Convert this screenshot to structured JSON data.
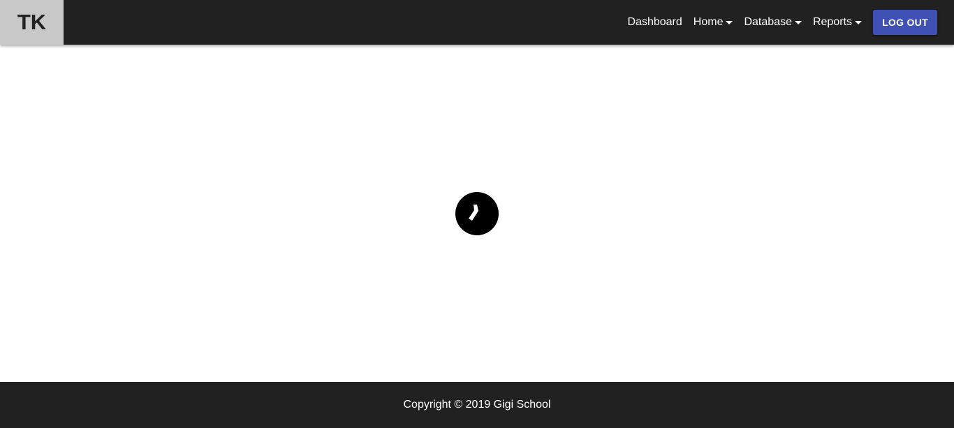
{
  "navbar": {
    "brand": "TK",
    "links": {
      "dashboard": "Dashboard",
      "home": "Home",
      "database": "Database",
      "reports": "Reports"
    },
    "logout_label": "LOG OUT"
  },
  "main": {
    "loader_icon": "clock-spinner-icon"
  },
  "footer": {
    "copyright": "Copyright © 2019 Gigi School"
  },
  "colors": {
    "navbar_bg": "#212121",
    "brand_bg": "#c8c8c8",
    "logout_bg": "#3f51b5",
    "footer_bg": "#212121"
  }
}
